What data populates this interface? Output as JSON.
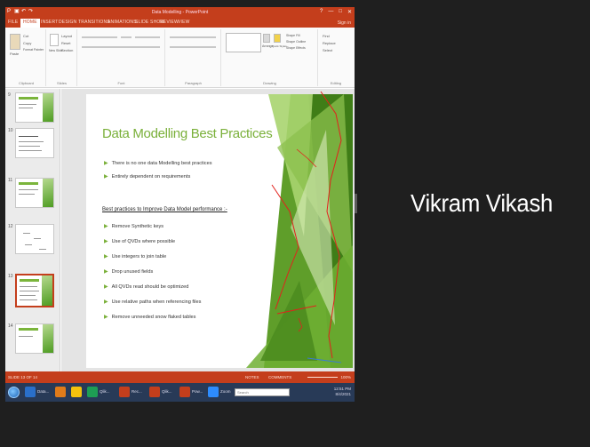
{
  "window": {
    "title": "Data Modelling - PowerPoint",
    "window_controls": [
      "?",
      "—",
      "□",
      "✕"
    ]
  },
  "ribbon_tabs": [
    "FILE",
    "HOME",
    "INSERT",
    "DESIGN",
    "TRANSITIONS",
    "ANIMATIONS",
    "SLIDE SHOW",
    "REVIEW",
    "VIEW"
  ],
  "user": "Sign in",
  "ribbon_groups": [
    "Clipboard",
    "Slides",
    "Font",
    "Paragraph",
    "Drawing",
    "Editing"
  ],
  "ribbon_buttons": {
    "cut": "Cut",
    "copy": "Copy",
    "paste": "Paste",
    "format_painter": "Format Painter",
    "new_slide": "New Slide",
    "layout": "Layout",
    "reset": "Reset",
    "section": "Section",
    "find": "Find",
    "replace": "Replace",
    "select": "Select",
    "shape_fill": "Shape Fill",
    "shape_outline": "Shape Outline",
    "shape_effects": "Shape Effects",
    "arrange": "Arrange",
    "quick_styles": "Quick Styles"
  },
  "thumbnails": [
    {
      "num": "9"
    },
    {
      "num": "10"
    },
    {
      "num": "11"
    },
    {
      "num": "12"
    },
    {
      "num": "13"
    },
    {
      "num": "14"
    }
  ],
  "slide": {
    "title": "Data Modelling Best Practices",
    "intro_bullets": [
      "There is no one data Modelling best practices",
      "Entirely dependent on requirements"
    ],
    "subheading": "Best practices to Improve Data Model performance :-",
    "practice_bullets": [
      "Remove Synthetic keys",
      "Use of QVDs where possible",
      "Use integers to join table",
      "Drop unused fields",
      "All QVDs read should be optimized",
      "Use relative paths when referencing files",
      "Remove unneeded snow flaked tables"
    ]
  },
  "statusbar": {
    "slide_info": "SLIDE 13 OF 14",
    "notes": "NOTES",
    "comments": "COMMENTS",
    "zoom": "100%"
  },
  "taskbar": {
    "items": [
      {
        "label": "Data...",
        "color": "#2a6fc9"
      },
      {
        "label": "",
        "color": "#e07b1a"
      },
      {
        "label": "",
        "color": "#f4c20d"
      },
      {
        "label": "Qlik...",
        "color": "#1e9e54"
      },
      {
        "label": "Rec...",
        "color": "#c43e1c"
      },
      {
        "label": "Qlik...",
        "color": "#c43e1c"
      },
      {
        "label": "Pow...",
        "color": "#c43e1c"
      },
      {
        "label": "Zoom",
        "color": "#2d8cff"
      }
    ],
    "search_placeholder": "Search",
    "clock_time": "12:51 PM",
    "clock_date": "8/4/2021"
  },
  "participant": {
    "name": "Vikram Vikash"
  },
  "colors": {
    "accent": "#c43e1c",
    "slide_green": "#7ab03a",
    "background": "#1f1f1f",
    "annotation": "#e3211c"
  }
}
